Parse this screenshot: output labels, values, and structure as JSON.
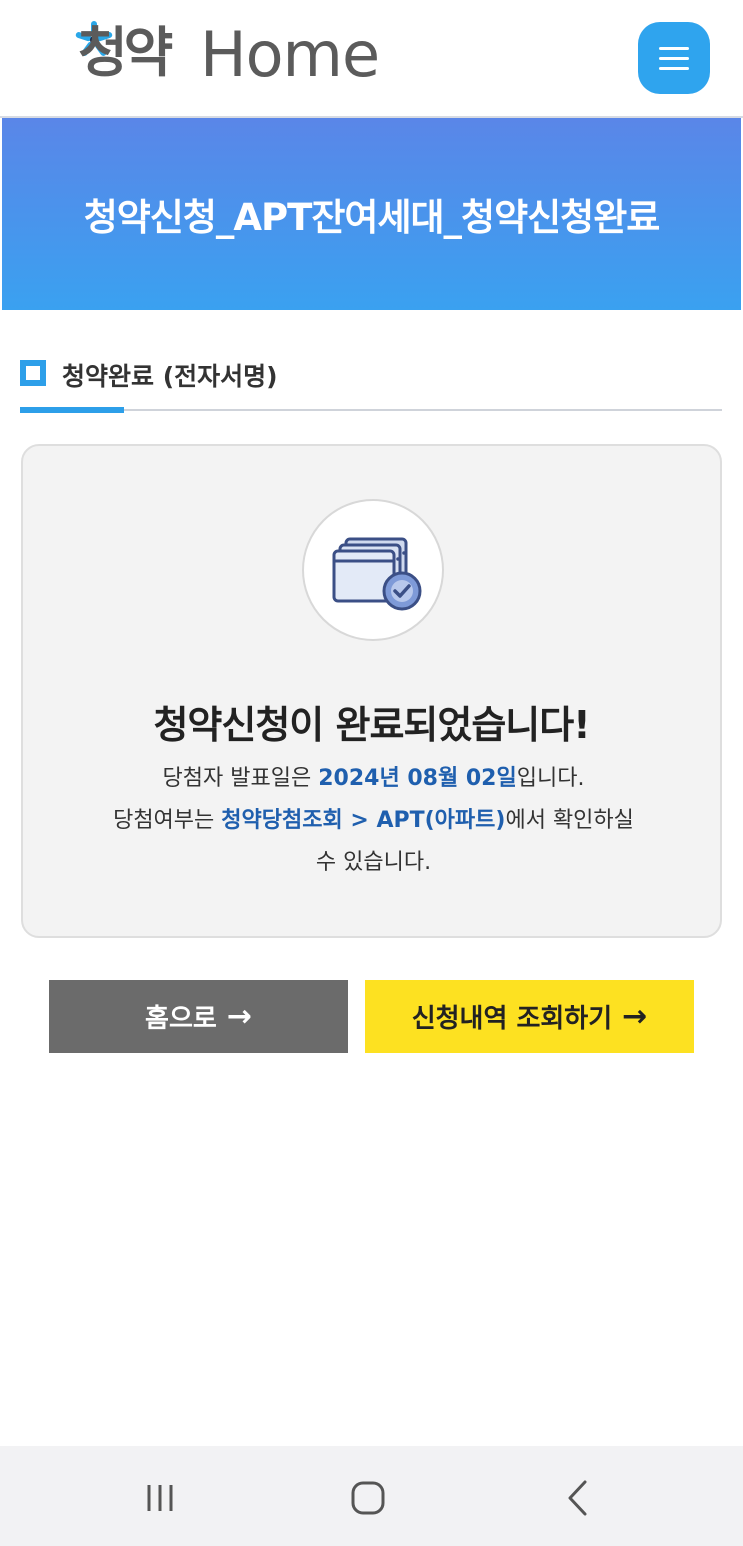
{
  "header": {
    "logo_kr": "청약",
    "logo_en": "Home",
    "menu_icon": "hamburger-icon",
    "accent": "#2fa4ee"
  },
  "banner": {
    "title": "청약신청_APT잔여세대_청약신청완료"
  },
  "section": {
    "title": "청약완료 (전자서명)"
  },
  "result": {
    "icon": "browser-windows-check-icon",
    "title": "청약신청이 완료되었습니다!",
    "line1_prefix": "당첨자 발표일은 ",
    "line1_date": "2024년 08월 02일",
    "line1_suffix": "입니다.",
    "line2_prefix": "당첨여부는 ",
    "line2_link": "청약당첨조회 > APT(아파트)",
    "line2_suffix": "에서 확인하실",
    "line3": "수 있습니다.",
    "highlight_color": "#1f5fae"
  },
  "buttons": {
    "home_label": "홈으로",
    "history_label": "신청내역 조회하기",
    "arrow": "→"
  },
  "system_nav": {
    "recent_icon": "recent-apps-icon",
    "home_icon": "home-icon",
    "back_icon": "back-icon"
  }
}
